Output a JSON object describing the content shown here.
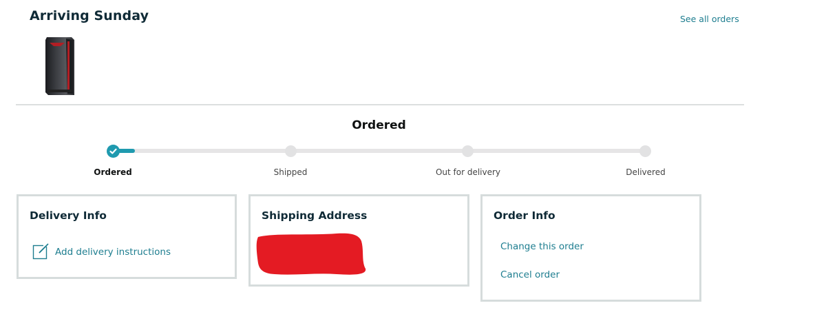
{
  "header": {
    "arrival": "Arriving Sunday",
    "see_all_orders": "See all orders"
  },
  "product": {
    "image_icon": "desktop-tower-icon",
    "colors": {
      "body": "#2b2c30",
      "accent": "#b21e24"
    }
  },
  "status": {
    "title": "Ordered",
    "progress_fraction": 0.04,
    "steps": [
      {
        "label": "Ordered",
        "state": "complete"
      },
      {
        "label": "Shipped",
        "state": "pending"
      },
      {
        "label": "Out for delivery",
        "state": "pending"
      },
      {
        "label": "Delivered",
        "state": "pending"
      }
    ]
  },
  "delivery_info": {
    "title": "Delivery Info",
    "add_instructions": "Add delivery instructions",
    "icon": "edit-note-icon"
  },
  "shipping_address": {
    "title": "Shipping Address",
    "redaction_color": "#e41b23"
  },
  "order_info": {
    "title": "Order Info",
    "change_order": "Change this order",
    "cancel_order": "Cancel order"
  },
  "colors": {
    "link": "#1d7d8f",
    "progress": "#1f9aaf",
    "card_border": "#d6dcdc",
    "heading": "#0f2a36"
  }
}
